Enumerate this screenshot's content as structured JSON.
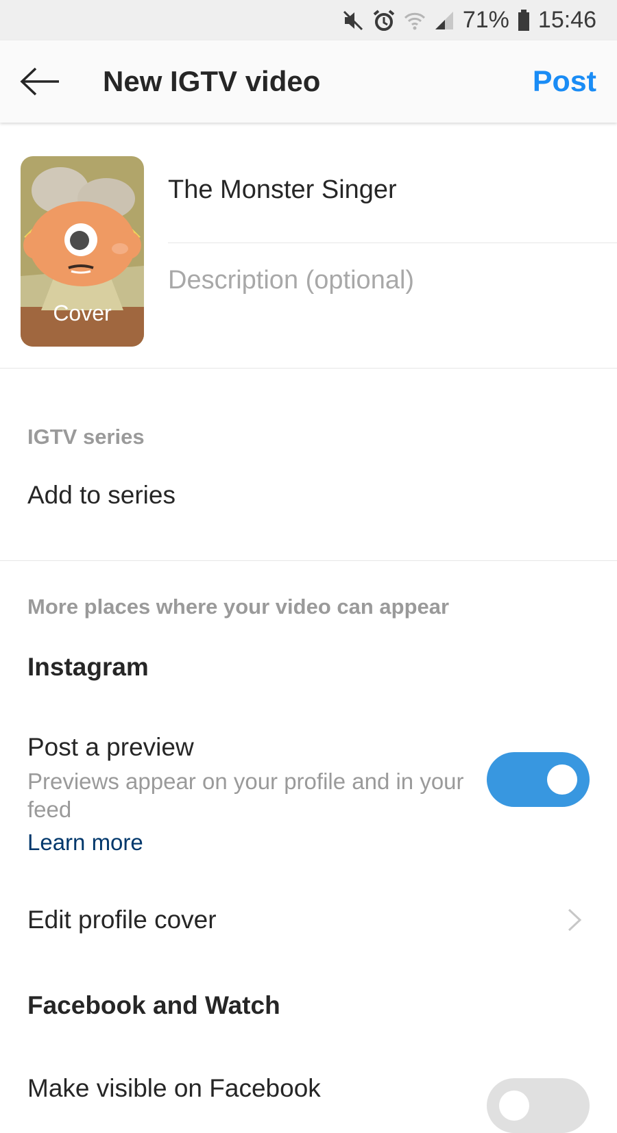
{
  "status_bar": {
    "battery": "71%",
    "time": "15:46",
    "icons": [
      "mute-icon",
      "alarm-icon",
      "wifi-icon",
      "signal-icon",
      "battery-icon"
    ]
  },
  "header": {
    "back_icon": "arrow-left-icon",
    "title": "New IGTV video",
    "post_label": "Post"
  },
  "video": {
    "cover_label": "Cover",
    "title_value": "The Monster Singer",
    "description_placeholder": "Description (optional)"
  },
  "series": {
    "section_label": "IGTV series",
    "add_label": "Add to series"
  },
  "places": {
    "section_label": "More places where your video can appear",
    "instagram_heading": "Instagram",
    "preview_title": "Post a preview",
    "preview_desc": "Previews appear on your profile and in your feed",
    "learn_more": "Learn more",
    "preview_enabled": true,
    "edit_cover_label": "Edit profile cover",
    "facebook_heading": "Facebook and Watch",
    "facebook_label": "Make visible on Facebook",
    "facebook_enabled": false
  },
  "colors": {
    "accent": "#1a8cf5",
    "toggle_on": "#3897e0",
    "link": "#00376b"
  }
}
